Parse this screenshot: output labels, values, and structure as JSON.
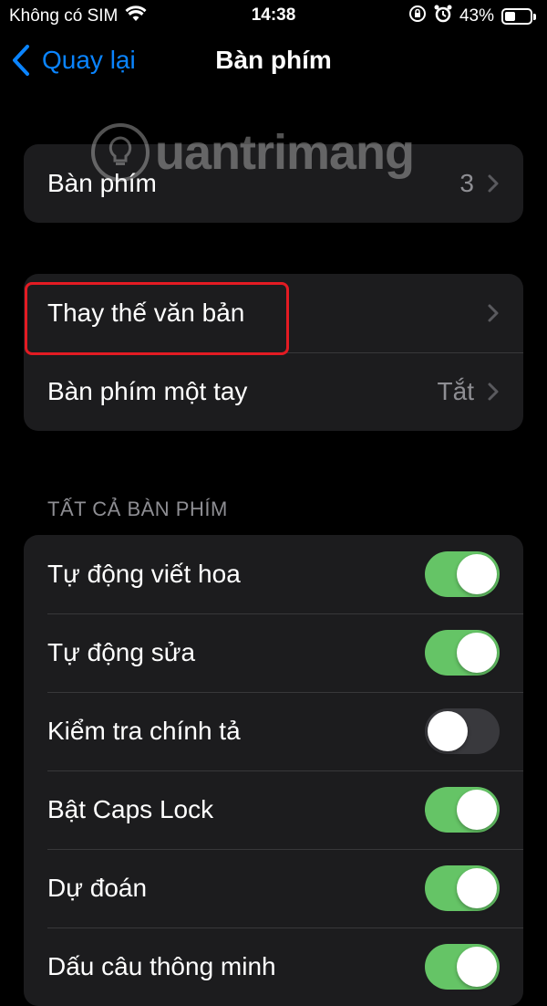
{
  "status_bar": {
    "carrier": "Không có SIM",
    "time": "14:38",
    "battery": "43%",
    "battery_level": 0.43
  },
  "nav": {
    "back_label": "Quay lại",
    "title": "Bàn phím"
  },
  "watermark": {
    "text": "uantrimang"
  },
  "group1": {
    "keyboards_label": "Bàn phím",
    "keyboards_value": "3"
  },
  "group2": {
    "text_replacement_label": "Thay thế văn bản",
    "one_handed_label": "Bàn phím một tay",
    "one_handed_value": "Tắt"
  },
  "section_all_keyboards": {
    "header": "TẤT CẢ BÀN PHÍM",
    "items": [
      {
        "label": "Tự động viết hoa",
        "on": true
      },
      {
        "label": "Tự động sửa",
        "on": true
      },
      {
        "label": "Kiểm tra chính tả",
        "on": false
      },
      {
        "label": "Bật Caps Lock",
        "on": true
      },
      {
        "label": "Dự đoán",
        "on": true
      },
      {
        "label": "Dấu câu thông minh",
        "on": true
      }
    ]
  },
  "colors": {
    "accent": "#0a84ff",
    "toggle_on": "#65c466",
    "toggle_off": "#39393d",
    "highlight": "#e31b23"
  }
}
